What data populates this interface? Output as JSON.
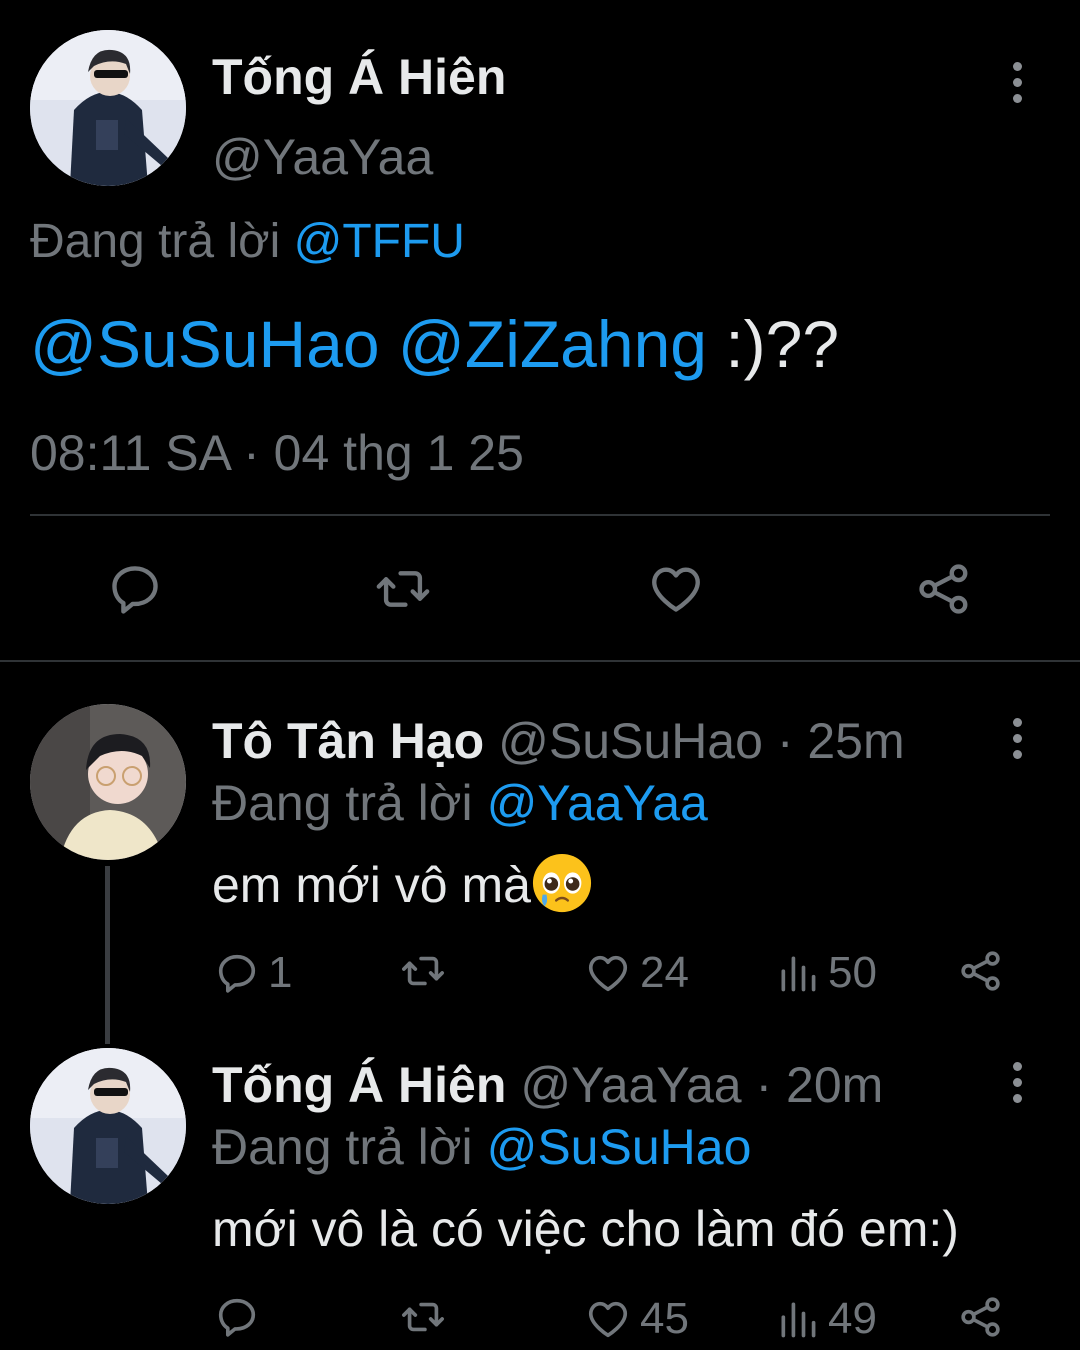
{
  "main_tweet": {
    "display_name": "Tống Á Hiên",
    "handle": "@YaaYaa",
    "replying_prefix": "Đang trả lời",
    "replying_to": "@TFFU",
    "mention_1": "@SuSuHao",
    "mention_2": "@ZiZahng",
    "body_suffix": ":)??",
    "timestamp": "08:11 SA · 04 thg 1 25"
  },
  "reply_1": {
    "display_name": "Tô Tân Hạo",
    "handle": "@SuSuHao",
    "time": "· 25m",
    "replying_prefix": "Đang trả lời",
    "replying_to": "@YaaYaa",
    "text": "em mới vô mà",
    "emoji": "🥹",
    "reply_count": "1",
    "retweet_count": "",
    "like_count": "24",
    "view_count": "50"
  },
  "reply_2": {
    "display_name": "Tống Á Hiên",
    "handle": "@YaaYaa",
    "time": "· 20m",
    "replying_prefix": "Đang trả lời",
    "replying_to": "@SuSuHao",
    "text": "mới vô là có việc cho làm đó em:)",
    "reply_count": "",
    "retweet_count": "",
    "like_count": "45",
    "view_count": "49"
  },
  "icons": {
    "reply": "reply-icon",
    "retweet": "retweet-icon",
    "like": "heart-icon",
    "views": "views-icon",
    "share": "share-icon",
    "more": "more-vertical-icon"
  },
  "colors": {
    "background": "#000000",
    "text": "#e7e9ea",
    "secondary": "#71767b",
    "link": "#1d9bf0",
    "divider": "#2f3336"
  }
}
